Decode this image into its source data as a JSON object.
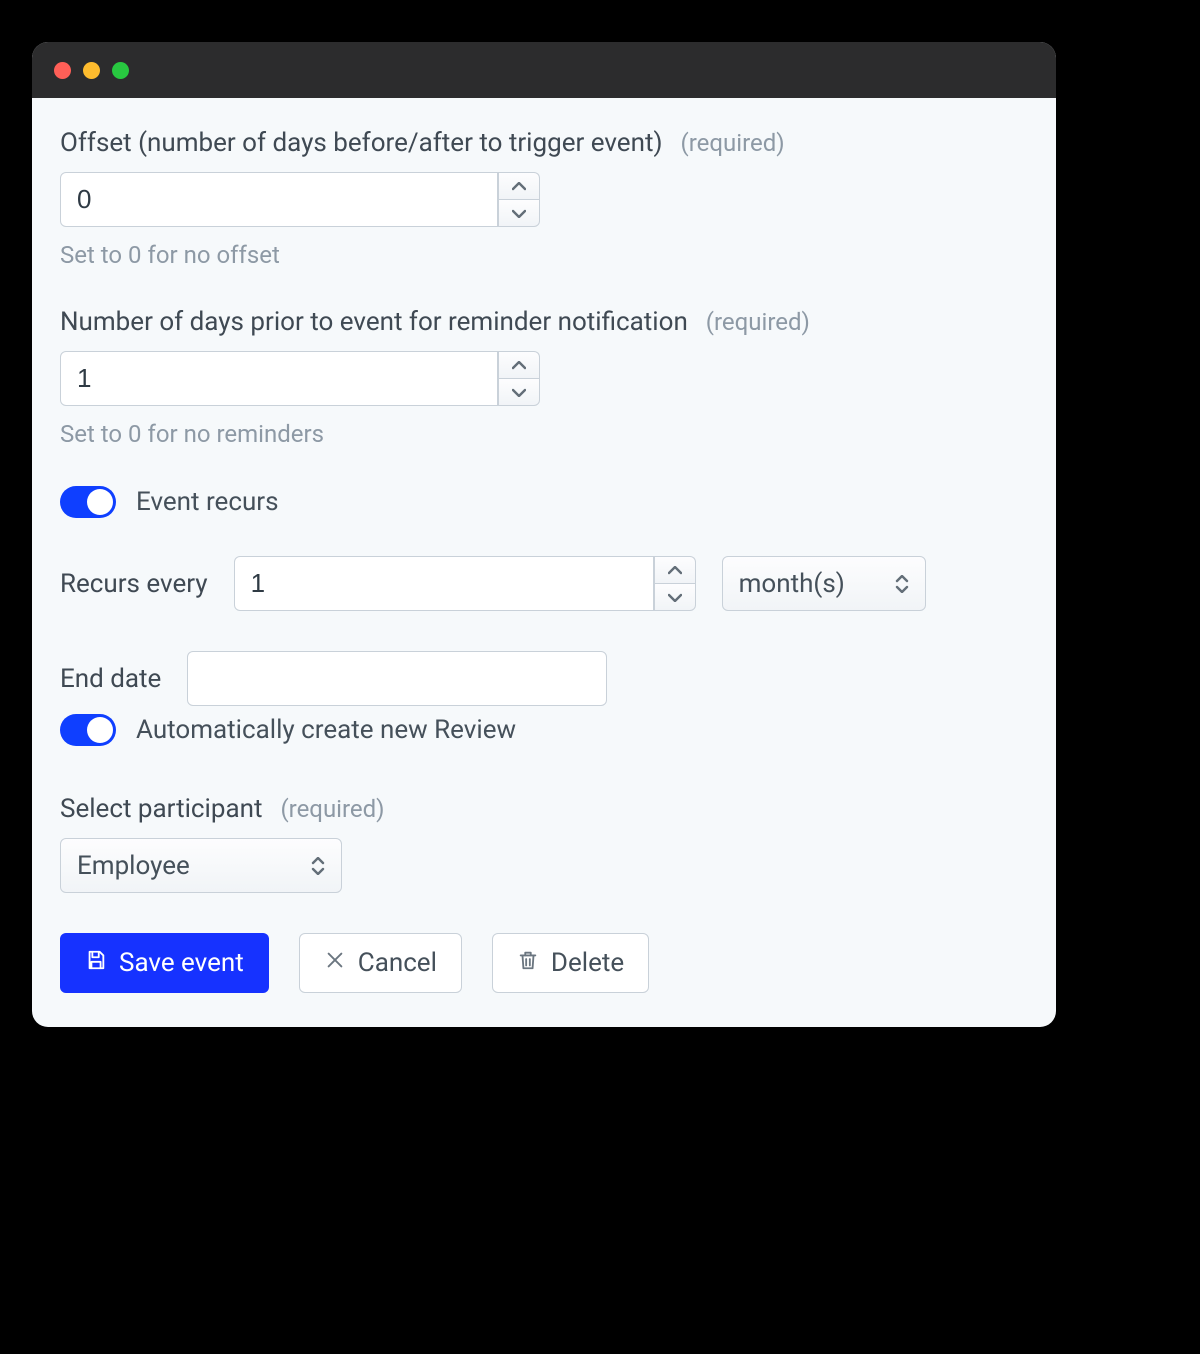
{
  "offset": {
    "label": "Offset (number of days before/after to trigger event)",
    "required_tag": "(required)",
    "value": "0",
    "hint": "Set to 0 for no offset"
  },
  "reminder": {
    "label": "Number of days prior to event for reminder notification",
    "required_tag": "(required)",
    "value": "1",
    "hint": "Set to 0 for no reminders"
  },
  "recurs_toggle": {
    "label": "Event recurs",
    "on": true
  },
  "recurs_every": {
    "label": "Recurs every",
    "value": "1",
    "unit_selected": "month(s)"
  },
  "end_date": {
    "label": "End date",
    "value": ""
  },
  "auto_review": {
    "label": "Automatically create new Review",
    "on": true
  },
  "participant": {
    "label": "Select participant",
    "required_tag": "(required)",
    "selected": "Employee"
  },
  "actions": {
    "save": "Save event",
    "cancel": "Cancel",
    "delete": "Delete"
  }
}
